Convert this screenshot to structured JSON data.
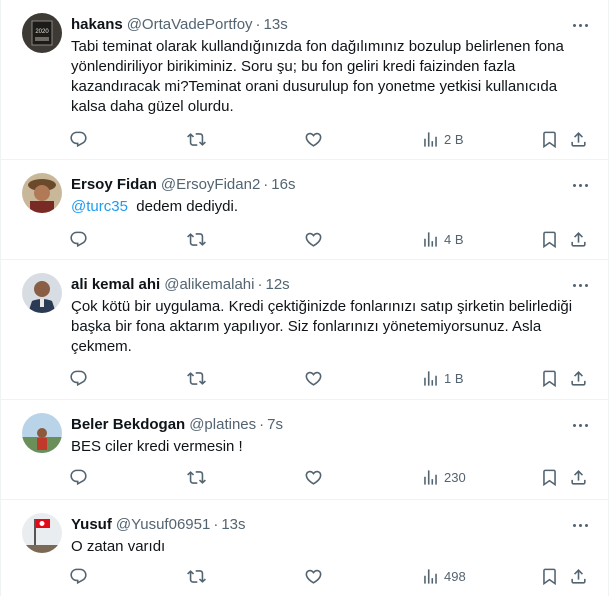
{
  "tweets": [
    {
      "name": "hakans",
      "handle": "@OrtaVadePortfoy",
      "time": "13s",
      "avatar_label": "2020",
      "mention": "",
      "text": "Tabi teminat olarak kullandığınızda fon dağılımınız bozulup belirlenen fona\nyönlendiriliyor birikiminiz. Soru şu; bu fon geliri kredi faizinden fazla\nkazandıracak mi?Teminat orani dusurulup fon yonetme yetkisi kullanıcıda\nkalsa daha güzel olurdu.",
      "views": "2 B"
    },
    {
      "name": "Ersoy Fidan",
      "handle": "@ErsoyFidan2",
      "time": "16s",
      "avatar_label": "",
      "mention": "@turc35",
      "text": "dedem dediydi.",
      "views": "4 B"
    },
    {
      "name": "ali kemal ahi",
      "handle": "@alikemalahi",
      "time": "12s",
      "avatar_label": "",
      "mention": "",
      "text": "Çok kötü bir uygulama. Kredi çektiğinizde fonlarınızı satıp şirketin belirlediği\nbaşka bir fona aktarım yapılıyor. Siz fonlarınızı yönetemiyorsunuz. Asla\nçekmem.",
      "views": "1 B"
    },
    {
      "name": "Beler Bekdogan",
      "handle": "@platines",
      "time": "7s",
      "avatar_label": "",
      "mention": "",
      "text": "BES ciler kredi vermesin !",
      "views": "230"
    },
    {
      "name": "Yusuf",
      "handle": "@Yusuf06951",
      "time": "13s",
      "avatar_label": "",
      "mention": "",
      "text": "O zatan varıdı",
      "views": "498"
    }
  ],
  "separator": "·",
  "icons": {
    "reply": "reply-icon",
    "retweet": "retweet-icon",
    "like": "like-icon",
    "views": "views-icon",
    "bookmark": "bookmark-icon",
    "share": "share-icon",
    "more": "more-icon"
  },
  "colors": {
    "text": "#0f1419",
    "secondary": "#536471",
    "link": "#1d9bf0",
    "divider": "#eff3f4"
  }
}
